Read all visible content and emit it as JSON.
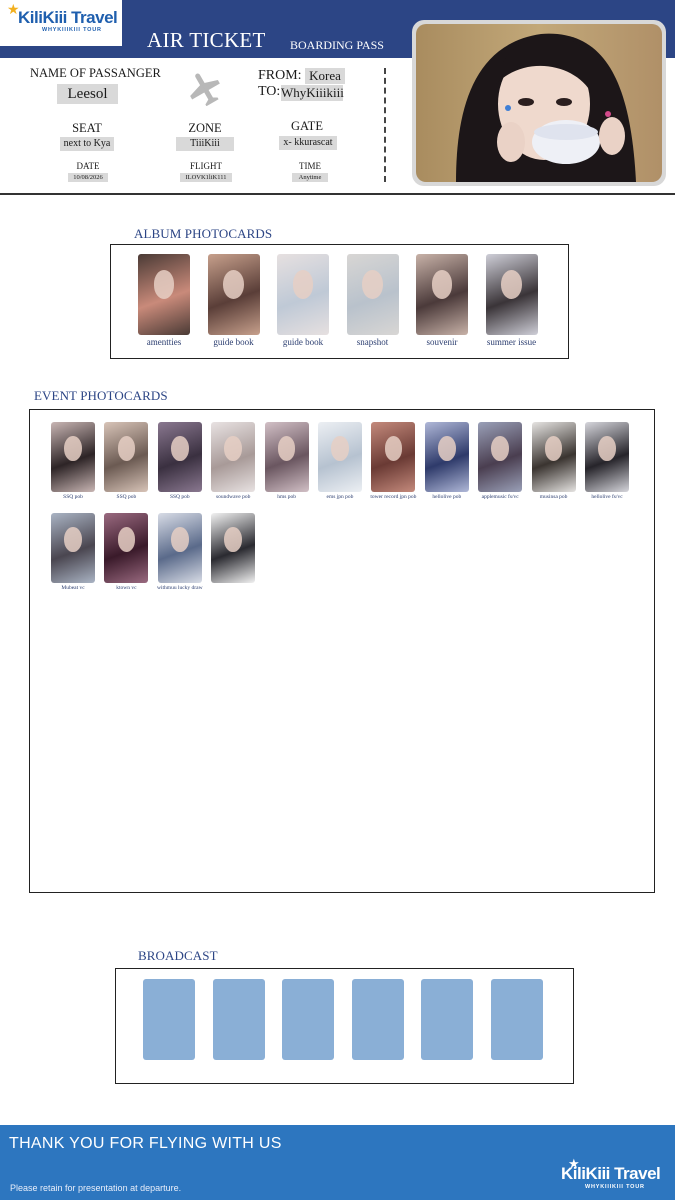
{
  "brand": {
    "logo_name": "KiliKiii Travel",
    "logo_tagline": "WHYKIIIKIII TOUR",
    "star_icon": "star-icon"
  },
  "header": {
    "title": "AIR TICKET",
    "subtitle": "BOARDING PASS"
  },
  "ticket": {
    "name_label": "NAME OF PASSANGER",
    "name_value": "Leesol",
    "from_label": "FROM:",
    "from_value": "Korea",
    "to_label": "TO:",
    "to_value": "WhyKiiikiii",
    "seat_label": "SEAT",
    "seat_value": "next to Kya",
    "zone_label": "ZONE",
    "zone_value": "TiiiKiii",
    "gate_label": "GATE",
    "gate_value": "x- kkurascat",
    "date_label": "DATE",
    "date_value": "10/08/2026",
    "flight_label": "FLIGHT",
    "flight_value": "ILOVK1liK111",
    "time_label": "TIME",
    "time_value": "Anytime"
  },
  "album": {
    "title": "ALBUM PHOTOCARDS",
    "cards": [
      {
        "caption": "amentties",
        "c1": "#c98a7a",
        "c2": "#4a3a35"
      },
      {
        "caption": "guide book",
        "c1": "#5a3e38",
        "c2": "#c7a08c"
      },
      {
        "caption": "guide book",
        "c1": "#bfc9d6",
        "c2": "#e6e0e0"
      },
      {
        "caption": "snapshot",
        "c1": "#b9c2cc",
        "c2": "#d8d6d4"
      },
      {
        "caption": "souvenir",
        "c1": "#4b3a3a",
        "c2": "#c8b2a8"
      },
      {
        "caption": "summer issue",
        "c1": "#3a3438",
        "c2": "#cfcfd8"
      }
    ]
  },
  "event": {
    "title": "EVENT PHOTOCARDS",
    "cards": [
      {
        "caption": "SSQ pob",
        "c1": "#2d2426",
        "c2": "#c9b6b4"
      },
      {
        "caption": "SSQ pob",
        "c1": "#6b5a52",
        "c2": "#d8c4b8"
      },
      {
        "caption": "SSQ pob",
        "c1": "#3a3040",
        "c2": "#8a7890"
      },
      {
        "caption": "soundwave pob",
        "c1": "#a89a98",
        "c2": "#e8e2e2"
      },
      {
        "caption": "hms pob",
        "c1": "#6a5660",
        "c2": "#d2c0c6"
      },
      {
        "caption": "ems jpn pob",
        "c1": "#b6c2d0",
        "c2": "#eceff3"
      },
      {
        "caption": "tower record jpn pob",
        "c1": "#6a3a34",
        "c2": "#c48a7c"
      },
      {
        "caption": "hellolive pob",
        "c1": "#2e3a6a",
        "c2": "#b0b8d8"
      },
      {
        "caption": "applemusic fs/vc",
        "c1": "#4a3e50",
        "c2": "#9aa0b8"
      },
      {
        "caption": "musinsa pob",
        "c1": "#3a3430",
        "c2": "#e6e4e2"
      },
      {
        "caption": "hellolive fs/vc",
        "c1": "#26242a",
        "c2": "#d6d6dc"
      },
      {
        "caption": "Mubeat vc",
        "c1": "#4a4650",
        "c2": "#aab4c4"
      },
      {
        "caption": "ktown vc",
        "c1": "#3a1a2a",
        "c2": "#9a6a80"
      },
      {
        "caption": "withmuu lucky draw",
        "c1": "#5a6a8a",
        "c2": "#d8dce6"
      },
      {
        "caption": "",
        "c1": "#2a2a30",
        "c2": "#f2f2f2"
      }
    ]
  },
  "broadcast": {
    "title": "BROADCAST",
    "slots": 6,
    "slot_color": "#8aafd6"
  },
  "footer": {
    "thanks": "THANK YOU FOR FLYING WITH US",
    "retain": "Please retain for presentation at departure.",
    "logo_name": "KiliKiii Travel",
    "logo_tagline": "WHYKIIIKIII TOUR"
  },
  "colors": {
    "header_blue": "#2c4585",
    "footer_blue": "#2d76bf",
    "section_title": "#2c4585"
  },
  "icons": [
    "airplane-icon",
    "star-icon"
  ]
}
